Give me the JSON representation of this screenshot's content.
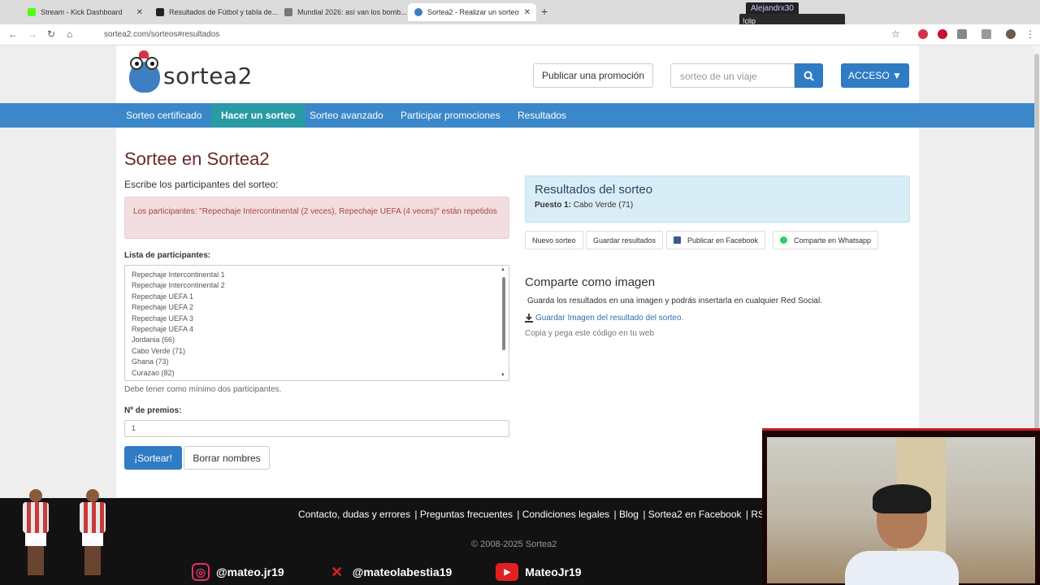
{
  "browser": {
    "tabs": [
      {
        "title": "Stream - Kick Dashboard",
        "color": "#53fc18"
      },
      {
        "title": "Resultados de Fútbol y tabla de...",
        "color": "#222222"
      },
      {
        "title": "Mundial 2026: así van los bomb...",
        "color": "#777777"
      },
      {
        "title": "Sortea2 - Realizar un sorteo",
        "color": "#3f7ec0"
      }
    ],
    "url": "sortea2.com/sorteos#resultados",
    "stream_user": "Alejandrx30",
    "clip_label": "!clip"
  },
  "header": {
    "logo_text": "sortea2",
    "publish_button": "Publicar una promoción",
    "search_placeholder": "sorteo de un viaje",
    "access_button": "ACCESO ▼"
  },
  "nav": {
    "items": [
      "Sorteo certificado",
      "Hacer un sorteo",
      "Sorteo avanzado",
      "Participar promociones",
      "Resultados"
    ]
  },
  "form": {
    "title": "Sortee en Sortea2",
    "subtitle": "Escribe los participantes del sorteo:",
    "alert": "Los participantes: \"Repechaje Intercontinental (2 veces), Repechaje UEFA (4 veces)\" están repetidos",
    "list_label": "Lista de participantes:",
    "participants": [
      "Repechaje Intercontinental 1",
      "Repechaje Intercontinental 2",
      "Repechaje UEFA 1",
      "Repechaje UEFA 2",
      "Repechaje UEFA 3",
      "Repechaje UEFA 4",
      "Jordania (66)",
      "Cabo Verde (71)",
      "Ghana (73)",
      "Curazao (82)"
    ],
    "help": "Debe tener como mínimo dos participantes.",
    "prizes_label": "Nº de premios:",
    "prizes_value": "1",
    "draw_button": "¡Sortear!",
    "clear_button": "Borrar nombres"
  },
  "results": {
    "title": "Resultados del sorteo",
    "place_label": "Puesto 1:",
    "place_value": "Cabo Verde (71)",
    "buttons": {
      "new": "Nuevo sorteo",
      "save": "Guardar resultados",
      "facebook": "Publicar en Facebook",
      "whatsapp": "Comparte en Whatsapp"
    }
  },
  "share": {
    "title": "Comparte como imagen",
    "text": "Guarda los resultados en una imagen y podrás insertarla en cualquier Red Social.",
    "link": "Guardar Imagen del resultado del sorteo.",
    "code": "Copia y pega este código en tu web"
  },
  "footer": {
    "links": [
      "Contacto, dudas y errores",
      "Preguntas frecuentes",
      "Condiciones legales",
      "Blog",
      "Sortea2 en Facebook",
      "RSS"
    ],
    "copyright": "© 2008-2025 Sortea2"
  },
  "overlay": {
    "socials": [
      "@mateo.jr19",
      "@mateolabestia19",
      "MateoJr19"
    ]
  },
  "colors": {
    "brand_blue": "#3a87c9",
    "active_tab": "#2a9aa5",
    "title_red": "#6b2a2a"
  }
}
